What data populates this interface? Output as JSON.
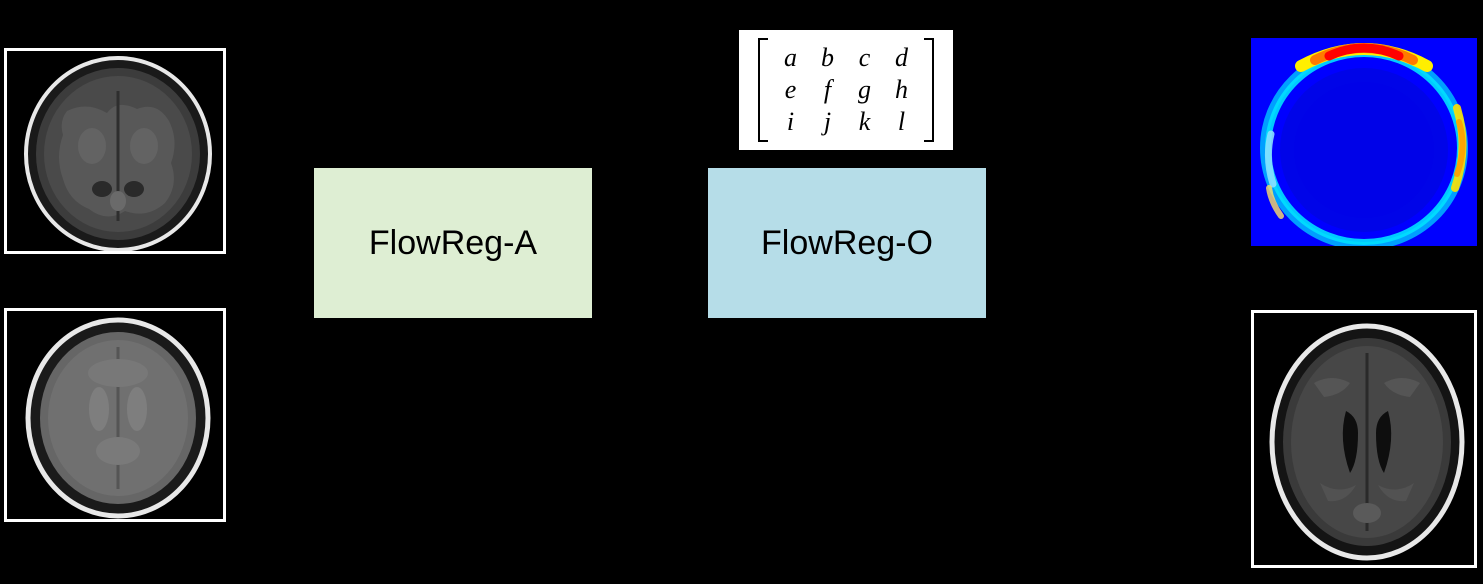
{
  "blocks": {
    "a": "FlowReg-A",
    "o": "FlowReg-O"
  },
  "matrix": {
    "rows": [
      [
        "a",
        "b",
        "c",
        "d"
      ],
      [
        "e",
        "f",
        "g",
        "h"
      ],
      [
        "i",
        "j",
        "k",
        "l"
      ]
    ]
  },
  "image_labels": {
    "top_left": "moving-volume-mri",
    "bottom_left": "fixed-template-mri",
    "top_right": "flow-field-heatmap",
    "bottom_right": "registered-volume-mri"
  },
  "colors": {
    "block_a_bg": "#deeed3",
    "block_o_bg": "#b6dde8",
    "heatmap_base": "#0000ff",
    "heatmap_ring_outer": "#00ffff",
    "heatmap_ring_hot": "#ff0000",
    "heatmap_ring_warm": "#ffff00"
  }
}
